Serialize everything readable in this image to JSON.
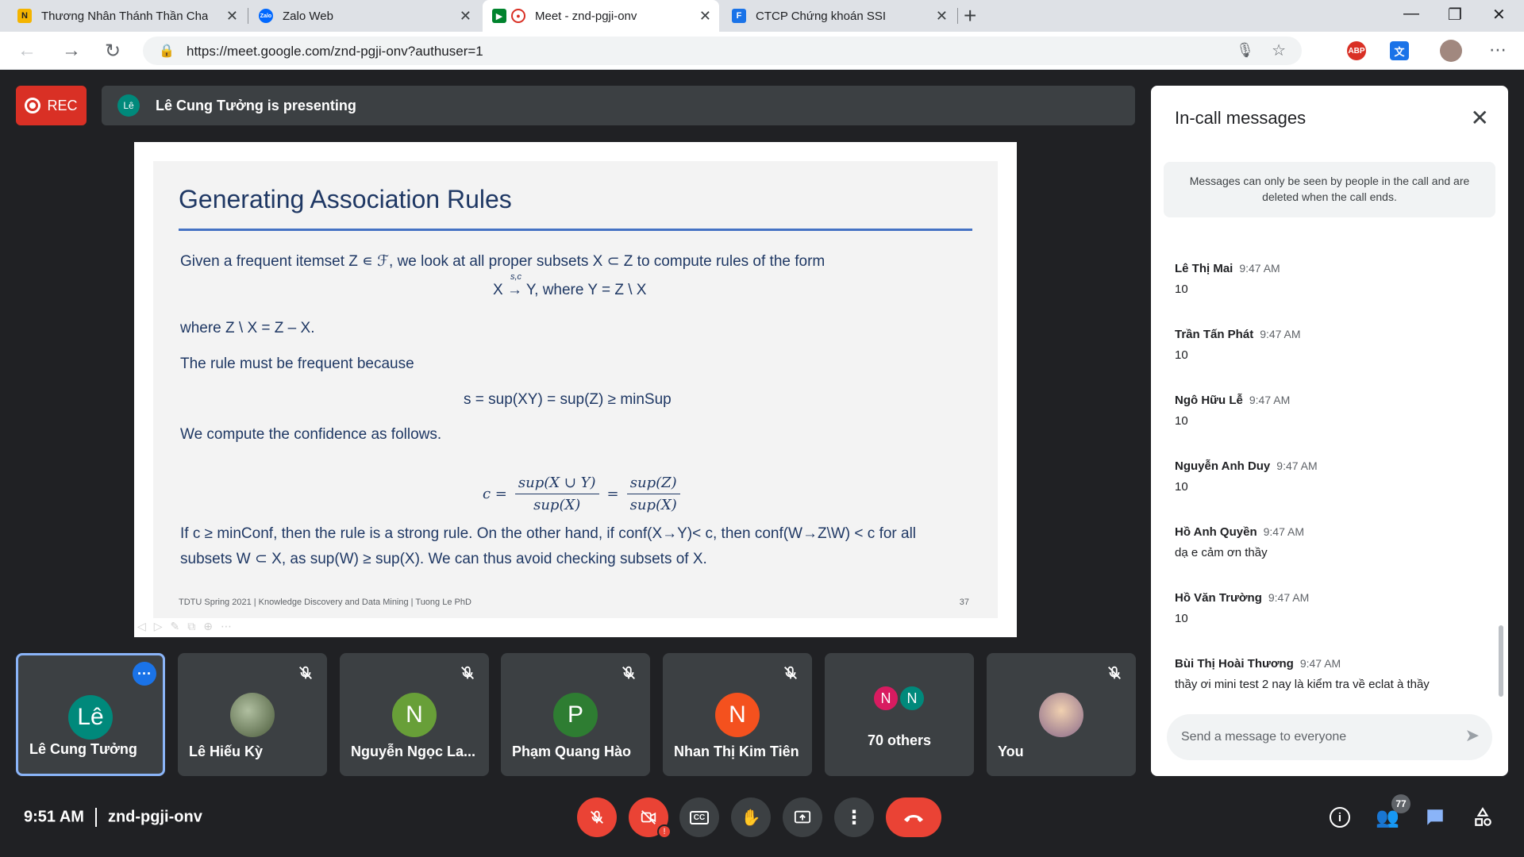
{
  "tabs": [
    {
      "title": "Thương Nhân Thánh Thần Chap",
      "favicon": "N",
      "favicon_color": "#f4b400"
    },
    {
      "title": "Zalo Web",
      "favicon": "Zalo",
      "favicon_color": "#0068ff"
    },
    {
      "title": "Meet - znd-pgji-onv",
      "favicon": "●",
      "favicon_color": "#d93025"
    },
    {
      "title": "CTCP Chứng khoán SSI",
      "favicon": "F",
      "favicon_color": "#1a73e8"
    }
  ],
  "address": {
    "url": "https://meet.google.com/znd-pgji-onv?authuser=1"
  },
  "extensions": {
    "abp": "ABP",
    "translate": "文"
  },
  "meet": {
    "rec_label": "REC",
    "presenter_initial": "Lê",
    "presenting_text": "Lê Cung Tưởng is presenting"
  },
  "slide": {
    "title": "Generating Association Rules",
    "p1": "Given a frequent itemset Z ∊ ℱ, we look at all proper subsets X ⊂ Z to compute rules of the form",
    "rule": "X →s,c Y, where Y = Z \\ X",
    "rule_x": "X",
    "rule_arrow": "→",
    "rule_sc": "s,c",
    "rule_rest": "Y, where Y = Z \\ X",
    "p2": "where Z \\ X = Z – X.",
    "p3": "The rule must be frequent because",
    "p4": "s = sup(XY) = sup(Z) ≥ minSup",
    "p5": "We compute the confidence as follows.",
    "f_c": "c =",
    "f_num1": "sup(X ∪ Y)",
    "f_den1": "sup(X)",
    "f_eq": "=",
    "f_num2": "sup(Z)",
    "f_den2": "sup(X)",
    "p6": "If c ≥ minConf, then the rule is a strong rule. On the other hand, if conf(X→Y)< c, then conf(W→Z\\W) < c for all",
    "p7": "subsets W ⊂ X, as sup(W) ≥ sup(X). We can thus avoid checking subsets of X.",
    "footer": "TDTU Spring 2021 | Knowledge Discovery and Data Mining | Tuong Le PhD",
    "page": "37"
  },
  "tiles": [
    {
      "name": "Lê Cung Tưởng",
      "initial": "Lê",
      "color": "#00897b"
    },
    {
      "name": "Lê Hiếu Kỳ",
      "initial": "",
      "color": "#6d8a5a"
    },
    {
      "name": "Nguyễn Ngọc La...",
      "initial": "N",
      "color": "#689f38"
    },
    {
      "name": "Phạm Quang Hào",
      "initial": "P",
      "color": "#2e7d32"
    },
    {
      "name": "Nhan Thị Kim Tiên",
      "initial": "N",
      "color": "#f4511e"
    },
    {
      "name": "70 others",
      "initial": "N",
      "color": "#d81b60",
      "initial2": "N",
      "color2": "#00897b"
    },
    {
      "name": "You",
      "initial": "",
      "color": "#c49a6c"
    }
  ],
  "bottom": {
    "time": "9:51 AM",
    "meeting_code": "znd-pgji-onv",
    "participants_count": "77"
  },
  "chat": {
    "title": "In-call messages",
    "notice": "Messages can only be seen by people in the call and are deleted when the call ends.",
    "messages": [
      {
        "sender": "Lê Thị Mai",
        "time": "9:47 AM",
        "text": "10"
      },
      {
        "sender": "Trần Tấn Phát",
        "time": "9:47 AM",
        "text": "10"
      },
      {
        "sender": "Ngô Hữu Lễ",
        "time": "9:47 AM",
        "text": "10"
      },
      {
        "sender": "Nguyễn Anh Duy",
        "time": "9:47 AM",
        "text": "10"
      },
      {
        "sender": "Hồ Anh Quyền",
        "time": "9:47 AM",
        "text": "dạ e cảm ơn thầy"
      },
      {
        "sender": "Hồ Văn Trường",
        "time": "9:47 AM",
        "text": "10"
      },
      {
        "sender": "Bùi Thị Hoài Thương",
        "time": "9:47 AM",
        "text": "thầy ơi mini test 2 nay là kiểm tra về eclat à thầy"
      }
    ],
    "input_placeholder": "Send a message to everyone"
  }
}
